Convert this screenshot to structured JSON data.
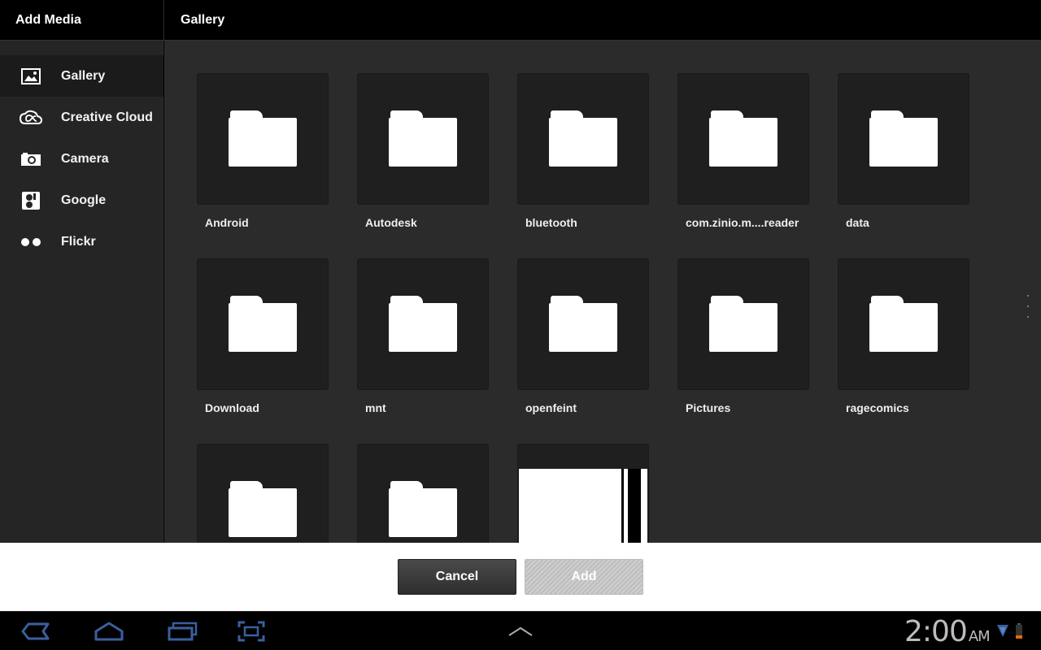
{
  "header": {
    "left_title": "Add Media",
    "right_title": "Gallery"
  },
  "sidebar": {
    "items": [
      {
        "label": "Gallery",
        "icon": "gallery-icon",
        "selected": true
      },
      {
        "label": "Creative Cloud",
        "icon": "creative-cloud-icon",
        "selected": false
      },
      {
        "label": "Camera",
        "icon": "camera-icon",
        "selected": false
      },
      {
        "label": "Google",
        "icon": "google-icon",
        "selected": false
      },
      {
        "label": "Flickr",
        "icon": "flickr-icon",
        "selected": false
      }
    ]
  },
  "gallery": {
    "tiles": [
      {
        "name": "Android",
        "type": "folder"
      },
      {
        "name": "Autodesk",
        "type": "folder"
      },
      {
        "name": "bluetooth",
        "type": "folder"
      },
      {
        "name": "com.zinio.m....reader",
        "type": "folder"
      },
      {
        "name": "data",
        "type": "folder"
      },
      {
        "name": "Download",
        "type": "folder"
      },
      {
        "name": "mnt",
        "type": "folder"
      },
      {
        "name": "openfeint",
        "type": "folder"
      },
      {
        "name": "Pictures",
        "type": "folder"
      },
      {
        "name": "ragecomics",
        "type": "folder"
      },
      {
        "name": "",
        "type": "folder"
      },
      {
        "name": "",
        "type": "folder"
      },
      {
        "name": "",
        "type": "image"
      }
    ]
  },
  "actions": {
    "cancel_label": "Cancel",
    "add_label": "Add",
    "add_enabled": false
  },
  "system_bar": {
    "time": "2:00",
    "ampm": "AM",
    "icons": [
      "back-icon",
      "home-icon",
      "recent-apps-icon",
      "screenshot-icon",
      "menu-up-icon",
      "wifi-icon",
      "battery-icon"
    ]
  },
  "colors": {
    "header_bg": "#000000",
    "sidebar_bg": "#252525",
    "main_bg": "#2b2b2b",
    "tile_bg": "#1f1f1f",
    "nav_icon": "#3b5998"
  }
}
